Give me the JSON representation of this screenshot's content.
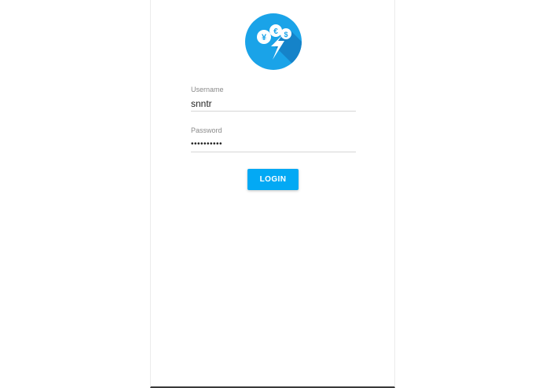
{
  "logo": {
    "icon": "currency-lightning-icon",
    "symbols": [
      "¥",
      "€",
      "$"
    ],
    "color": "#03a9f4"
  },
  "form": {
    "username": {
      "label": "Username",
      "value": "snntr"
    },
    "password": {
      "label": "Password",
      "value": "••••••••••"
    },
    "login_label": "LOGIN"
  },
  "colors": {
    "accent": "#03a9f4",
    "underline": "#d6d6d6",
    "label": "#8a8a8a"
  }
}
